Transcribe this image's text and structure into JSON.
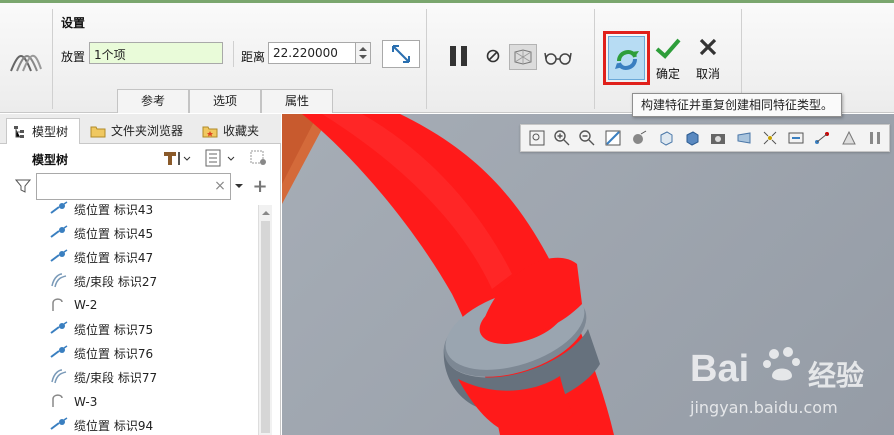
{
  "ribbon": {
    "settings_title": "设置",
    "placement_label": "放置",
    "placement_value": "1个项",
    "distance_label": "距离",
    "distance_value": "22.220000",
    "ok_label": "确定",
    "cancel_label": "取消",
    "tabs": [
      "参考",
      "选项",
      "属性"
    ]
  },
  "tooltip": "构建特征并重复创建相同特征类型。",
  "panel": {
    "tabs": [
      "模型树",
      "文件夹浏览器",
      "收藏夹"
    ],
    "tree_title": "模型树",
    "search_placeholder": "",
    "items": [
      {
        "label": "缆位置 标识43",
        "icon": "cable-location-icon"
      },
      {
        "label": "缆位置 标识45",
        "icon": "cable-location-icon"
      },
      {
        "label": "缆位置 标识47",
        "icon": "cable-location-icon"
      },
      {
        "label": "缆/束段 标识27",
        "icon": "cable-segment-icon"
      },
      {
        "label": "W-2",
        "icon": "wire-icon"
      },
      {
        "label": "缆位置 标识75",
        "icon": "cable-location-icon"
      },
      {
        "label": "缆位置 标识76",
        "icon": "cable-location-icon"
      },
      {
        "label": "缆/束段 标识77",
        "icon": "cable-segment-icon"
      },
      {
        "label": "W-3",
        "icon": "wire-icon"
      },
      {
        "label": "缆位置 标识94",
        "icon": "cable-location-icon"
      }
    ]
  },
  "watermark": {
    "brand": "Bai",
    "brand2": "经验",
    "url": "jingyan.baidu.com"
  },
  "colors": {
    "accent_green": "#2e9e3a",
    "highlight_red": "#e0201b",
    "cable_red": "#ff1a1a",
    "clamp_gray": "#8f9aa6"
  }
}
